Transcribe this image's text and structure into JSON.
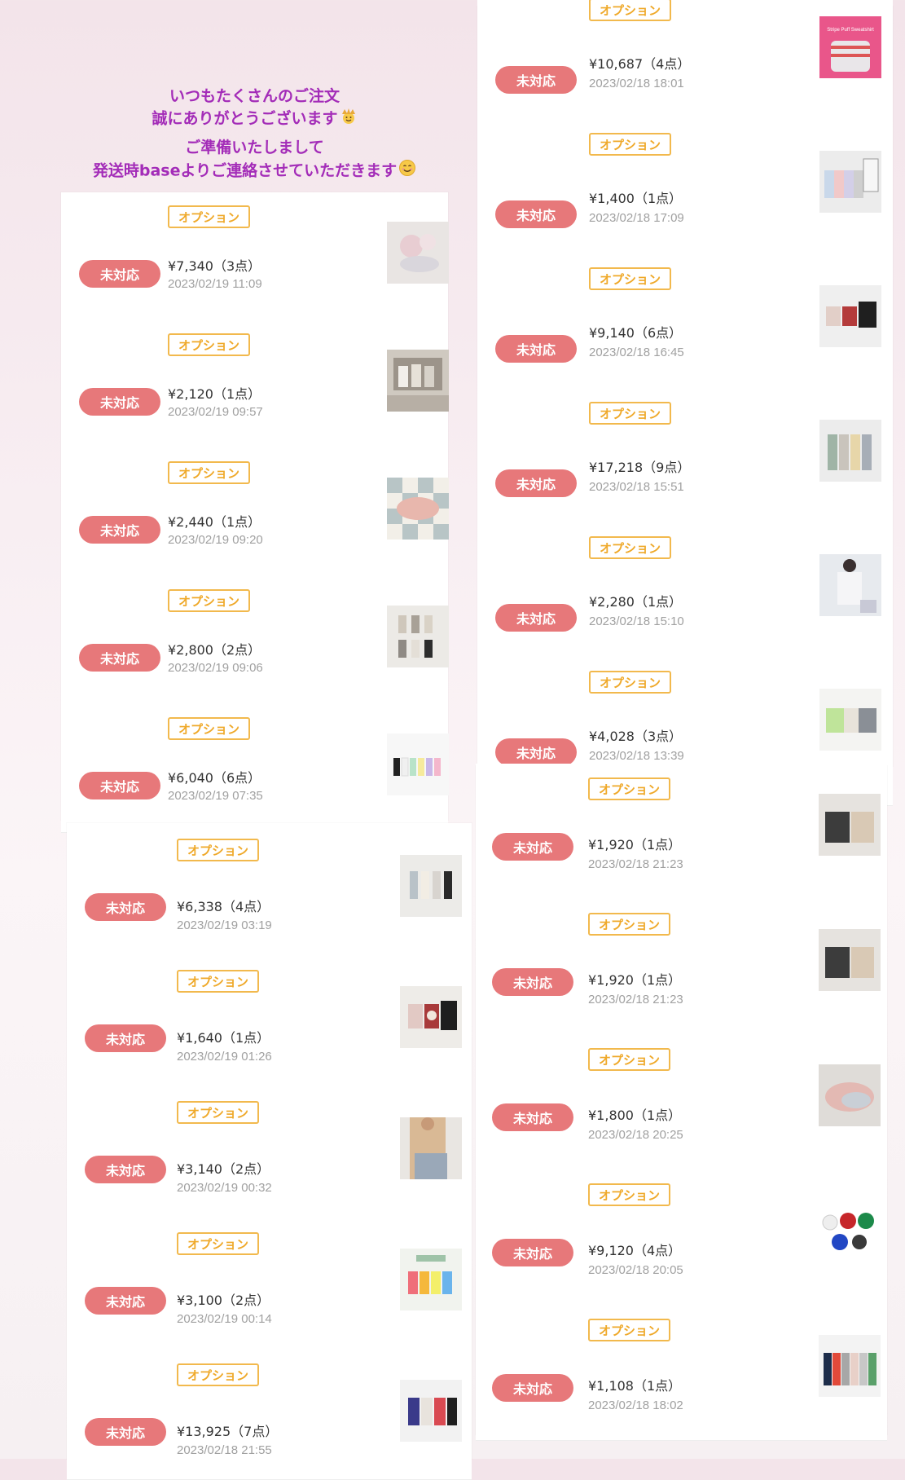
{
  "message": {
    "line1": "いつもたくさんのご注文",
    "line2": "誠にありがとうございます",
    "line3": "ご準備いたしまして",
    "line4": "発送時baseよりご連絡させていただきます"
  },
  "labels": {
    "status": "未対応",
    "option": "オプション"
  },
  "panels": [
    {
      "id": "left-top",
      "orders": [
        {
          "price": "¥7,340（3点）",
          "date": "2023/02/19 11:09"
        },
        {
          "price": "¥2,120（1点）",
          "date": "2023/02/19 09:57"
        },
        {
          "price": "¥2,440（1点）",
          "date": "2023/02/19 09:20"
        },
        {
          "price": "¥2,800（2点）",
          "date": "2023/02/19 09:06"
        },
        {
          "price": "¥6,040（6点）",
          "date": "2023/02/19 07:35"
        }
      ]
    },
    {
      "id": "left-bottom",
      "orders": [
        {
          "price": "¥6,338（4点）",
          "date": "2023/02/19 03:19"
        },
        {
          "price": "¥1,640（1点）",
          "date": "2023/02/19 01:26"
        },
        {
          "price": "¥3,140（2点）",
          "date": "2023/02/19 00:32"
        },
        {
          "price": "¥3,100（2点）",
          "date": "2023/02/19 00:14"
        },
        {
          "price": "¥13,925（7点）",
          "date": "2023/02/18 21:55"
        }
      ]
    },
    {
      "id": "right-top",
      "orders": [
        {
          "price": "¥10,687（4点）",
          "date": "2023/02/18 18:01"
        },
        {
          "price": "¥1,400（1点）",
          "date": "2023/02/18 17:09"
        },
        {
          "price": "¥9,140（6点）",
          "date": "2023/02/18 16:45"
        },
        {
          "price": "¥17,218（9点）",
          "date": "2023/02/18 15:51"
        },
        {
          "price": "¥2,280（1点）",
          "date": "2023/02/18 15:10"
        },
        {
          "price": "¥4,028（3点）",
          "date": "2023/02/18 13:39"
        }
      ]
    },
    {
      "id": "right-bottom",
      "orders": [
        {
          "price": "¥1,920（1点）",
          "date": "2023/02/18 21:23"
        },
        {
          "price": "¥1,920（1点）",
          "date": "2023/02/18 21:23"
        },
        {
          "price": "¥1,800（1点）",
          "date": "2023/02/18 20:25"
        },
        {
          "price": "¥9,120（4点）",
          "date": "2023/02/18 20:05"
        },
        {
          "price": "¥1,108（1点）",
          "date": "2023/02/18 18:02"
        }
      ]
    }
  ],
  "thumbnail_text": {
    "sweatshirt": "Stripe Puff Sweatshirt"
  },
  "colors": {
    "badge": "#e7787a",
    "option": "#f2b94d",
    "message": "#a32cb8",
    "date": "#a0a0a0"
  }
}
